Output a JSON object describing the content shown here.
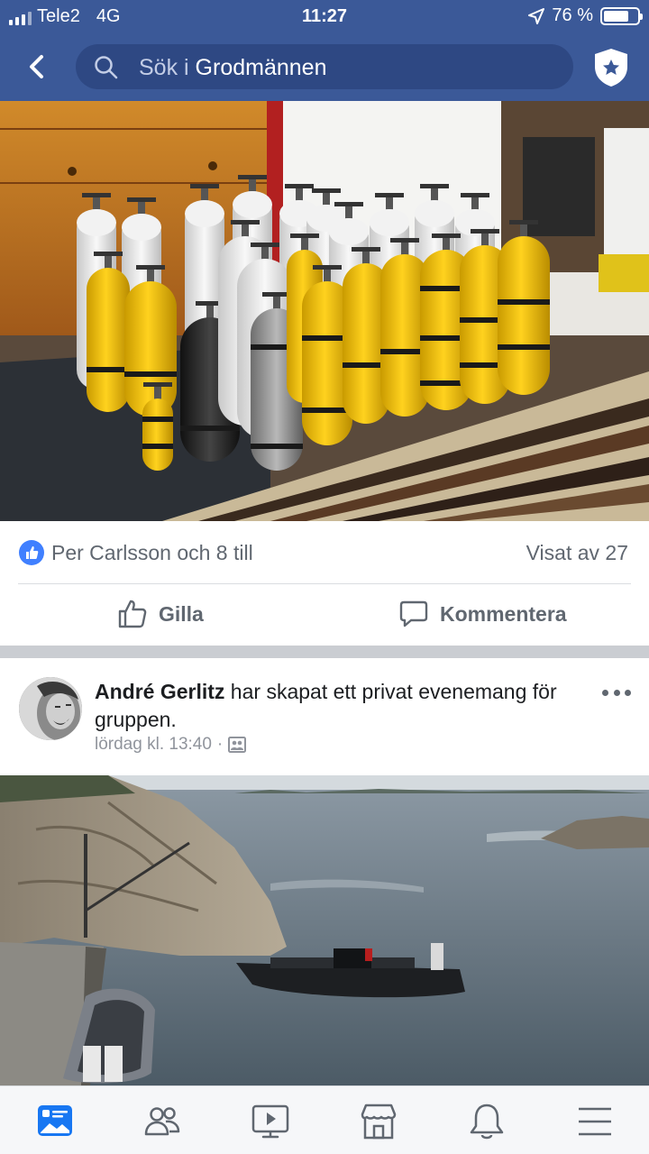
{
  "status_bar": {
    "carrier": "Tele2",
    "network": "4G",
    "time": "11:27",
    "battery": "76 %",
    "battery_level": 0.76
  },
  "header": {
    "search_prefix": "Sök i",
    "search_group": "Grodmännen",
    "accent": "#3b5998"
  },
  "post1": {
    "reactors": "Per Carlsson och 8 till",
    "views": "Visat av 27",
    "like_label": "Gilla",
    "comment_label": "Kommentera"
  },
  "post2": {
    "author": "André Gerlitz",
    "text": " har skapat ett privat evenemang för gruppen.",
    "time": "lördag kl. 13:40",
    "separator": "·",
    "privacy_icon": "group-icon"
  },
  "bottom_nav": {
    "items": [
      "news-feed-icon",
      "friends-icon",
      "watch-icon",
      "marketplace-icon",
      "notifications-icon",
      "menu-icon"
    ],
    "active_color": "#1877f2"
  }
}
